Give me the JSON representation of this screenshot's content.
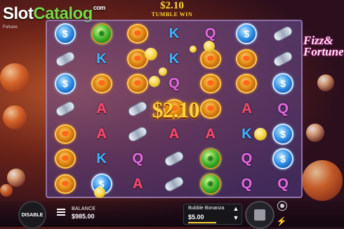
{
  "watermark": {
    "slot": "Slot",
    "catalog": "Catalog",
    "tld": "com"
  },
  "header": {
    "win_amount": "$2.10",
    "win_label": "TUMBLE WIN",
    "sublabel": "Fortune"
  },
  "logo": {
    "line1": "Fizz",
    "line2": "&",
    "line3": "Fortune"
  },
  "grid": {
    "rows": [
      [
        "coin-blue",
        "coin-green",
        "medal",
        "K",
        "Q",
        "coin-blue",
        "capsule"
      ],
      [
        "capsule",
        "K",
        "medal",
        "K",
        "medal",
        "medal",
        "capsule"
      ],
      [
        "coin-blue",
        "medal",
        "medal",
        "Q",
        "medal",
        "medal",
        "coin-blue"
      ],
      [
        "capsule",
        "A",
        "capsule",
        "medal",
        "medal",
        "A",
        "Q"
      ],
      [
        "medal",
        "A",
        "capsule",
        "A",
        "A",
        "K",
        "coin-blue"
      ],
      [
        "medal",
        "K",
        "Q",
        "capsule",
        "coin-green",
        "Q",
        "coin-blue"
      ],
      [
        "medal",
        "coin-blue",
        "A",
        "capsule",
        "coin-green",
        "Q",
        "Q"
      ]
    ]
  },
  "center_win": "$2.10",
  "controls": {
    "disable_label": "DISABLE",
    "balance_label": "BALANCE",
    "balance_value": "$985.00",
    "bet_game": "Bubble Bonanza",
    "bet_value": "$5.00",
    "chevron_up": "▲",
    "chevron_down": "▼",
    "turbo": "⚡"
  },
  "colors": {
    "gold": "#ffd23d",
    "k_blue": "#39b6ff",
    "q_pink": "#e46ae6",
    "a_red": "#ff4a6a"
  }
}
